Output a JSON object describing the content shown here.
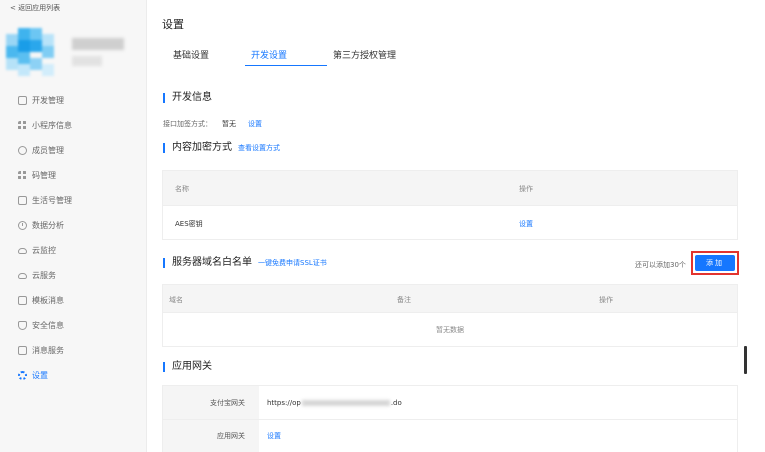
{
  "sidebar": {
    "back_label": "< 返回应用列表",
    "items": [
      {
        "label": "开发管理",
        "icon": "code-icon"
      },
      {
        "label": "小程序信息",
        "icon": "grid-icon"
      },
      {
        "label": "成员管理",
        "icon": "member-icon"
      },
      {
        "label": "码管理",
        "icon": "qrcode-icon"
      },
      {
        "label": "生活号管理",
        "icon": "lifenumber-icon"
      },
      {
        "label": "数据分析",
        "icon": "chart-icon"
      },
      {
        "label": "云监控",
        "icon": "cloud-icon"
      },
      {
        "label": "云服务",
        "icon": "cloud-service-icon"
      },
      {
        "label": "模板消息",
        "icon": "message-icon"
      },
      {
        "label": "安全信息",
        "icon": "shield-icon"
      },
      {
        "label": "消息服务",
        "icon": "message-service-icon"
      },
      {
        "label": "设置",
        "icon": "gear-icon",
        "active": true
      }
    ]
  },
  "main": {
    "title": "设置",
    "tabs": [
      {
        "label": "基础设置"
      },
      {
        "label": "开发设置",
        "active": true
      },
      {
        "label": "第三方授权管理"
      }
    ],
    "dev_info": {
      "title": "开发信息",
      "sign_label": "接口加签方式：",
      "sign_value": "暂无",
      "sign_action": "设置"
    },
    "encrypt": {
      "title": "内容加密方式",
      "link": "查看设置方式",
      "columns": [
        "名称",
        "操作"
      ],
      "rows": [
        {
          "name": "AES密钥",
          "action": "设置"
        }
      ]
    },
    "whitelist": {
      "title": "服务器域名白名单",
      "link": "一键免费申请SSL证书",
      "remaining": "还可以添加30个",
      "add_label": "添加",
      "columns": [
        "域名",
        "备注",
        "操作"
      ],
      "empty_text": "暂无数据"
    },
    "gateway": {
      "title": "应用网关",
      "rows": [
        {
          "label": "支付宝网关",
          "value_prefix": "https://op",
          "value_suffix": ".do"
        },
        {
          "label": "应用网关",
          "action": "设置"
        }
      ]
    }
  },
  "colors": {
    "accent": "#1677ff",
    "highlight_border": "#e3342f"
  }
}
